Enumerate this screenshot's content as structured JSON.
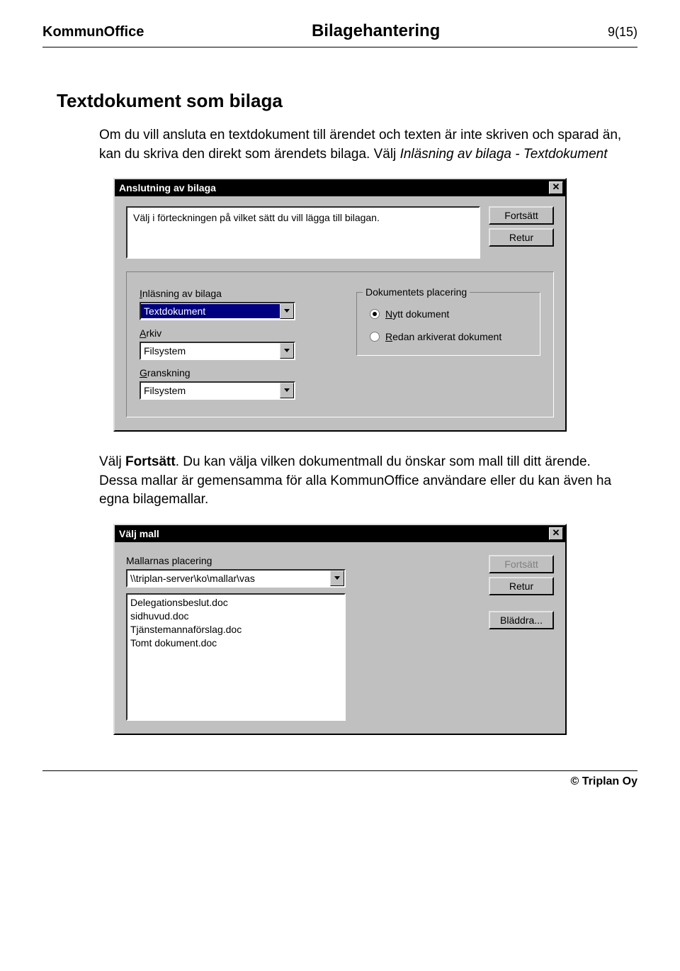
{
  "header": {
    "left": "KommunOffice",
    "center": "Bilagehantering",
    "right": "9(15)"
  },
  "section_title": "Textdokument som bilaga",
  "intro": {
    "part1": "Om du vill ansluta en textdokument till ärendet och texten är inte skriven och sparad än, kan du skriva den direkt som ärendets bilaga. Välj ",
    "italic": "Inläsning av bilaga - Textdokument"
  },
  "dialog1": {
    "title": "Anslutning av bilaga",
    "instruction": "Välj i förteckningen på vilket sätt du vill lägga till bilagan.",
    "buttons": {
      "continue": "Fortsätt",
      "return": "Retur"
    },
    "fields": {
      "inlasning_label_pre": "I",
      "inlasning_label_post": "nläsning av bilaga",
      "inlasning_value": "Textdokument",
      "arkiv_label_pre": "A",
      "arkiv_label_post": "rkiv",
      "arkiv_value": "Filsystem",
      "granskning_label_pre": "G",
      "granskning_label_post": "ranskning",
      "granskning_value": "Filsystem"
    },
    "groupbox": {
      "title": "Dokumentets placering",
      "opt1_pre": "N",
      "opt1_post": "ytt dokument",
      "opt2_pre": "R",
      "opt2_post": "edan arkiverat dokument"
    }
  },
  "mid": {
    "part1": "Välj ",
    "bold": "Fortsätt",
    "part2": ". Du kan välja vilken dokumentmall du önskar som mall till ditt ärende. Dessa mallar är gemensamma för alla KommunOffice användare eller du kan även ha egna bilagemallar."
  },
  "dialog2": {
    "title": "Välj mall",
    "label": "Mallarnas placering",
    "path": "\\\\triplan-server\\ko\\mallar\\vas",
    "items": [
      "Delegationsbeslut.doc",
      "sidhuvud.doc",
      "Tjänstemannaförslag.doc",
      "Tomt dokument.doc"
    ],
    "buttons": {
      "continue": "Fortsätt",
      "return": "Retur",
      "browse": "Bläddra..."
    }
  },
  "footer": "© Triplan Oy"
}
